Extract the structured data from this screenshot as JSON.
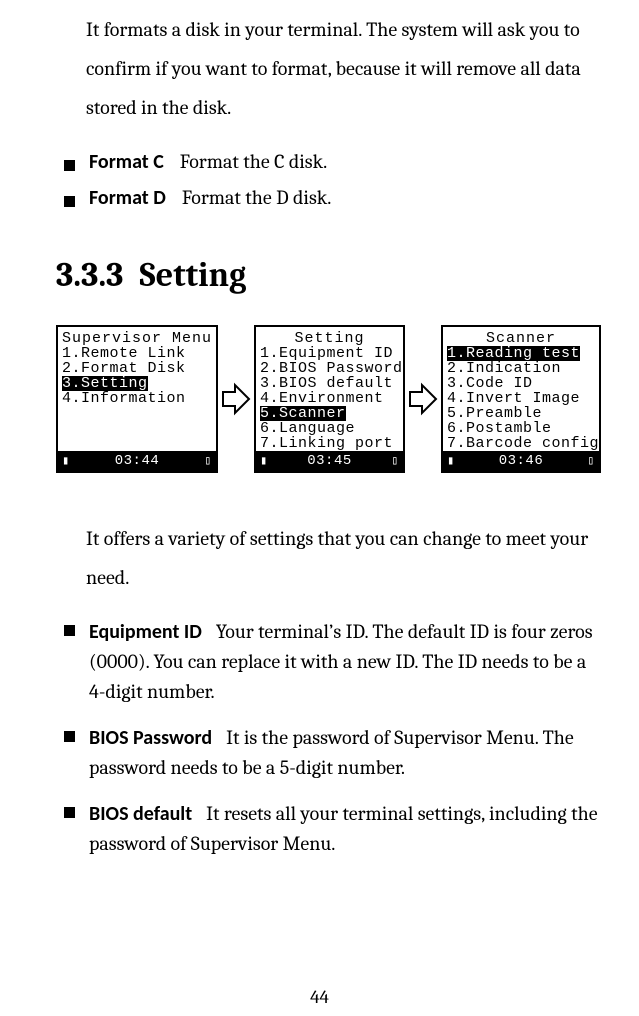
{
  "intro": "It formats a disk in your terminal. The system will ask you to confirm if you want to format, because it will remove all data stored in the disk.",
  "format_items": [
    {
      "term": "Format C",
      "desc": "Format the C disk."
    },
    {
      "term": "Format D",
      "desc": "Format the D disk."
    }
  ],
  "section": {
    "num": "3.3.3",
    "title": "Setting"
  },
  "screens": {
    "s1": {
      "title": "Supervisor Menu",
      "lines": [
        "1.Remote Link",
        "2.Format Disk",
        "3.Setting",
        "4.Information"
      ],
      "selected_index": 2,
      "status": "03:44"
    },
    "s2": {
      "title": "Setting",
      "lines": [
        "1.Equipment ID",
        "2.BIOS Password",
        "3.BIOS default",
        "4.Environment",
        "5.Scanner",
        "6.Language",
        "7.Linking port"
      ],
      "selected_index": 4,
      "status": "03:45"
    },
    "s3": {
      "title": "Scanner",
      "lines": [
        "1.Reading test",
        "2.Indication",
        "3.Code ID",
        "4.Invert Image",
        "5.Preamble",
        "6.Postamble",
        "7.Barcode config"
      ],
      "selected_index": 0,
      "status": "03:46"
    }
  },
  "setting_intro": "It offers a variety of settings that you can change to meet your need.",
  "setting_items": [
    {
      "term": "Equipment ID",
      "desc": "Your terminal’s ID. The default ID is four zeros (0000). You can replace it with a new ID. The ID needs to be a 4-digit number."
    },
    {
      "term": "BIOS Password",
      "desc": "It is the password of Supervisor Menu. The password needs to be a 5-digit number."
    },
    {
      "term": "BIOS default",
      "desc": "It resets all your terminal settings, including the password of Supervisor Menu."
    }
  ],
  "page_number": "44"
}
